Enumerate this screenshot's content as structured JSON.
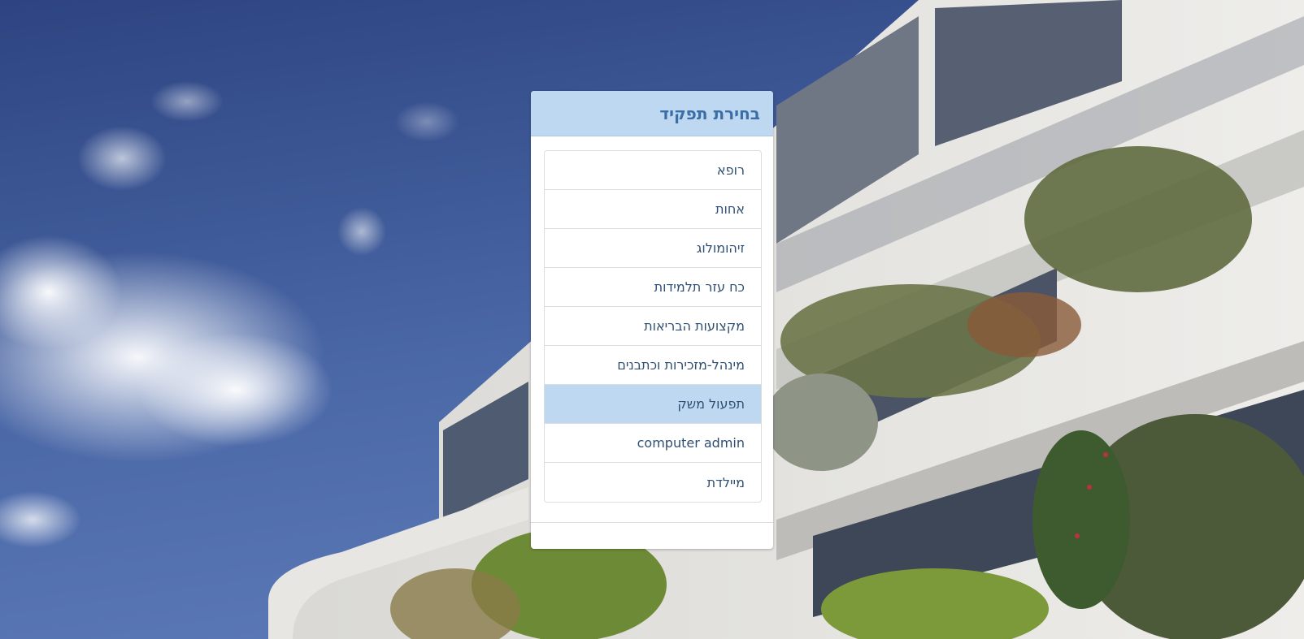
{
  "page": {
    "title": "בחירת תפקיד"
  },
  "roles": [
    {
      "label": "רופא"
    },
    {
      "label": "אחות"
    },
    {
      "label": "זיהומולוג"
    },
    {
      "label": "כח עזר תלמידות"
    },
    {
      "label": "מקצועות הבריאות"
    },
    {
      "label": "מינהל-מזכירות וכתבנים"
    },
    {
      "label": "תפעול משק",
      "selected": true
    },
    {
      "label": "computer admin"
    },
    {
      "label": "מיילדת"
    }
  ],
  "colors": {
    "header_bg": "#bed8f1",
    "title_text": "#3a6ea5",
    "selected_bg": "#bed8f1",
    "item_text": "#2f4f73",
    "sky": "#3f5a94"
  }
}
